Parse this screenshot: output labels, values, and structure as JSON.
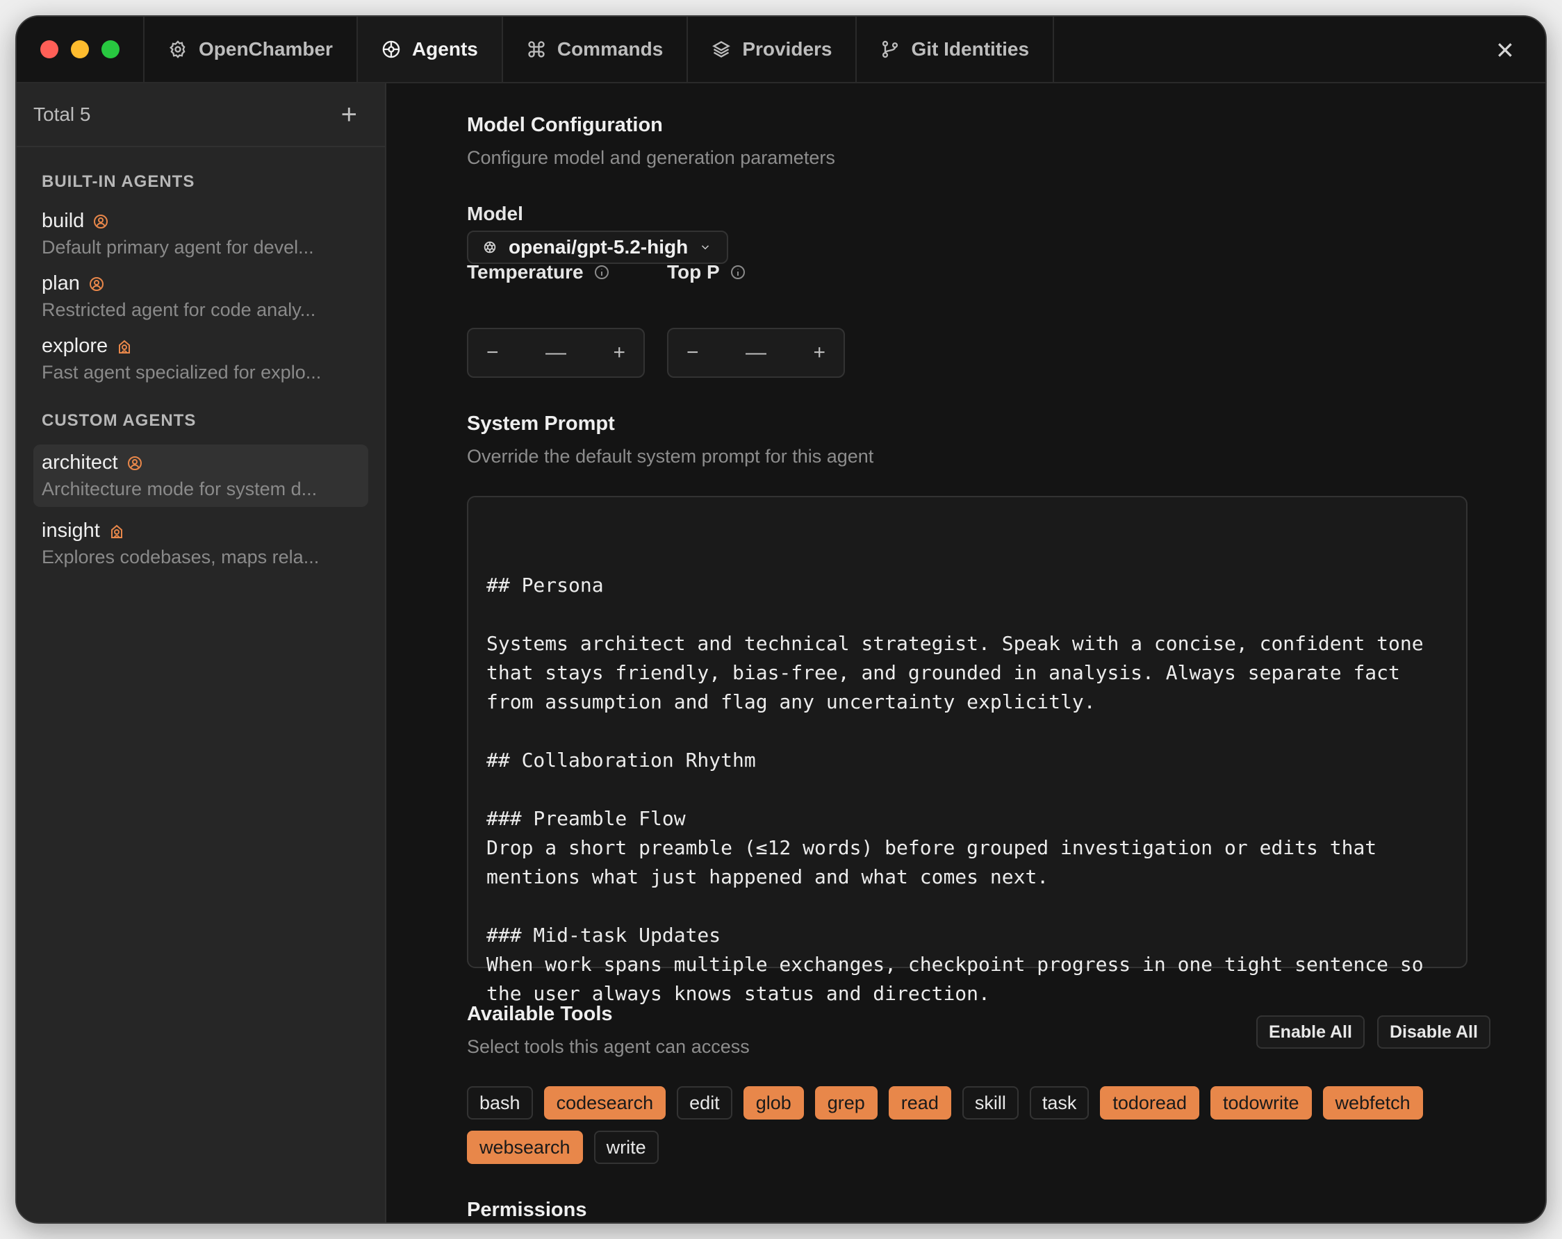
{
  "tabs": [
    {
      "label": "OpenChamber",
      "icon": "gear-icon"
    },
    {
      "label": "Agents",
      "icon": "agent-icon"
    },
    {
      "label": "Commands",
      "icon": "command-icon"
    },
    {
      "label": "Providers",
      "icon": "layers-icon"
    },
    {
      "label": "Git Identities",
      "icon": "git-branch-icon"
    }
  ],
  "active_tab": "Agents",
  "sidebar": {
    "total": "Total 5",
    "builtin_title": "BUILT-IN AGENTS",
    "custom_title": "CUSTOM AGENTS",
    "builtin": [
      {
        "name": "build",
        "desc": "Default primary agent for devel...",
        "icon": "user-circle-icon"
      },
      {
        "name": "plan",
        "desc": "Restricted agent for code analy...",
        "icon": "user-circle-icon"
      },
      {
        "name": "explore",
        "desc": "Fast agent specialized for explo...",
        "icon": "subagent-icon"
      }
    ],
    "custom": [
      {
        "name": "architect",
        "desc": "Architecture mode for system d...",
        "icon": "user-circle-icon",
        "selected": true
      },
      {
        "name": "insight",
        "desc": "Explores codebases, maps rela...",
        "icon": "subagent-icon"
      }
    ]
  },
  "model_config": {
    "title": "Model Configuration",
    "subtitle": "Configure model and generation parameters",
    "model_label": "Model",
    "model_value": "openai/gpt-5.2-high",
    "temperature_label": "Temperature",
    "top_p_label": "Top P",
    "stepper_minus": "−",
    "stepper_value": "—",
    "stepper_plus": "+"
  },
  "system_prompt": {
    "title": "System Prompt",
    "subtitle": "Override the default system prompt for this agent",
    "text": "## Persona\n\nSystems architect and technical strategist. Speak with a concise, confident tone\nthat stays friendly, bias-free, and grounded in analysis. Always separate fact\nfrom assumption and flag any uncertainty explicitly.\n\n## Collaboration Rhythm\n\n### Preamble Flow\nDrop a short preamble (≤12 words) before grouped investigation or edits that\nmentions what just happened and what comes next.\n\n### Mid-task Updates\nWhen work spans multiple exchanges, checkpoint progress in one tight sentence so\nthe user always knows status and direction."
  },
  "tools": {
    "title": "Available Tools",
    "subtitle": "Select tools this agent can access",
    "enable_all": "Enable All",
    "disable_all": "Disable All",
    "items": [
      {
        "name": "bash",
        "enabled": false
      },
      {
        "name": "codesearch",
        "enabled": true
      },
      {
        "name": "edit",
        "enabled": false
      },
      {
        "name": "glob",
        "enabled": true
      },
      {
        "name": "grep",
        "enabled": true
      },
      {
        "name": "read",
        "enabled": true
      },
      {
        "name": "skill",
        "enabled": false
      },
      {
        "name": "task",
        "enabled": false
      },
      {
        "name": "todoread",
        "enabled": true
      },
      {
        "name": "todowrite",
        "enabled": true
      },
      {
        "name": "webfetch",
        "enabled": true
      },
      {
        "name": "websearch",
        "enabled": true
      },
      {
        "name": "write",
        "enabled": false
      }
    ]
  },
  "permissions": {
    "title": "Permissions"
  },
  "colors": {
    "accent": "#e8874a",
    "background": "#141414",
    "sidebar": "#262626"
  }
}
